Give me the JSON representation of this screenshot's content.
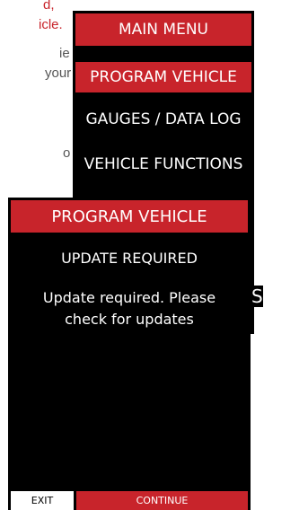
{
  "background_text": {
    "line1_red": "d,",
    "line2_red": "icle.",
    "line3": "ie",
    "line4": "your",
    "line5": "o"
  },
  "back_screen": {
    "header": "MAIN MENU",
    "items": [
      {
        "label": "PROGRAM VEHICLE",
        "selected": true
      },
      {
        "label": "GAUGES / DATA LOG",
        "selected": false
      },
      {
        "label": "VEHICLE FUNCTIONS",
        "selected": false
      }
    ],
    "partial_text": "S"
  },
  "front_screen": {
    "header": "PROGRAM VEHICLE",
    "subtitle": "UPDATE REQUIRED",
    "message": "Update required. Please check for updates",
    "exit_label": "EXIT",
    "continue_label": "CONTINUE"
  },
  "colors": {
    "accent": "#c8242b",
    "screen": "#000000"
  }
}
